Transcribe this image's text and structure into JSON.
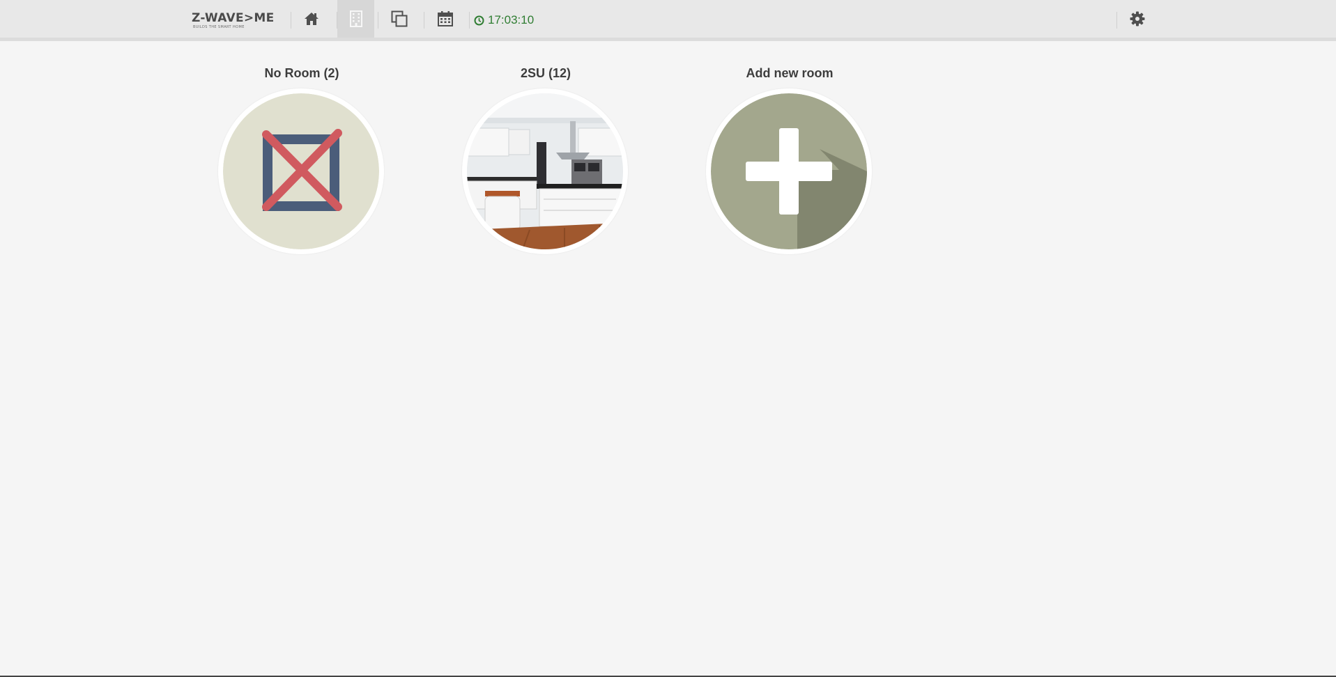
{
  "brand": {
    "name": "Z-WAVE>ME",
    "tagline": "BUILDS THE SMART HOME"
  },
  "nav": {
    "items": [
      {
        "name": "home",
        "icon": "home-icon",
        "active": false
      },
      {
        "name": "rooms",
        "icon": "building-icon",
        "active": true
      },
      {
        "name": "elements",
        "icon": "copy-icon",
        "active": false
      },
      {
        "name": "events",
        "icon": "calendar-icon",
        "active": false
      }
    ]
  },
  "clock": {
    "time": "17:03:10",
    "icon": "clock-icon",
    "color": "#2f7d32"
  },
  "settings": {
    "icon": "gear-icon"
  },
  "rooms": [
    {
      "title": "No Room (2)",
      "icon": "no-room-icon"
    },
    {
      "title": "2SU (12)",
      "icon": "kitchen-photo"
    },
    {
      "title": "Add new room",
      "icon": "plus-icon"
    }
  ],
  "colors": {
    "clock": "#2f7d32",
    "no_room_bg": "#e0e0cf",
    "no_room_frame": "#4b5d7a",
    "no_room_cross": "#d05a5f",
    "add_room_bg": "#a3a78d",
    "add_room_shadow": "#82866f"
  }
}
